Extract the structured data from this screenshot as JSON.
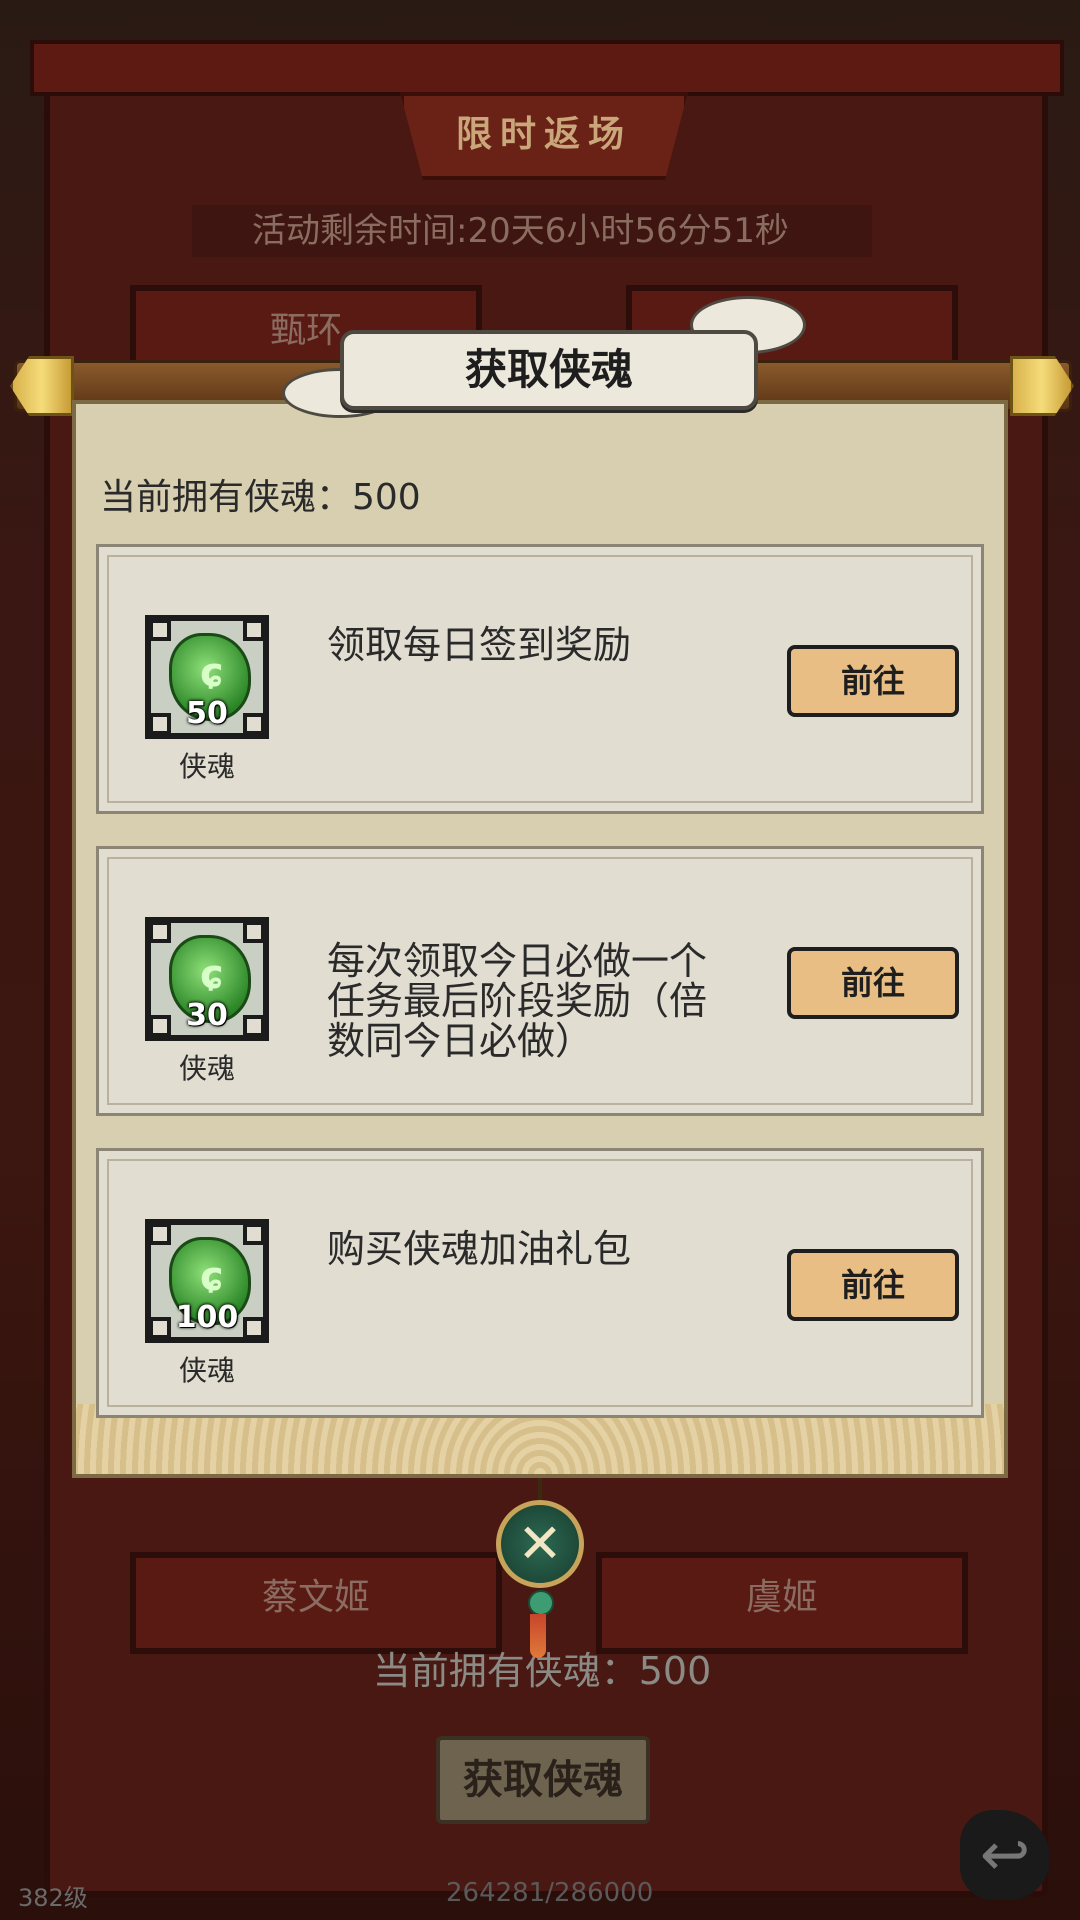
{
  "background": {
    "banner_title": "限时返场",
    "timer_text": "活动剩余时间:20天6小时56分51秒",
    "characters": [
      {
        "name": "甄环"
      },
      {
        "name": "蔡文姬"
      },
      {
        "name": "虞姬"
      }
    ],
    "owned_text": "当前拥有侠魂：500",
    "get_button_label": "获取侠魂",
    "level_text": "382级",
    "progress_text": "264281/286000"
  },
  "dialog": {
    "title": "获取侠魂",
    "owned_text": "当前拥有侠魂：500",
    "tasks": [
      {
        "reward_name": "侠魂",
        "reward_qty": "50",
        "description": "领取每日签到奖励",
        "button_label": "前往"
      },
      {
        "reward_name": "侠魂",
        "reward_qty": "30",
        "description": "每次领取今日必做一个任务最后阶段奖励（倍数同今日必做）",
        "button_label": "前往"
      },
      {
        "reward_name": "侠魂",
        "reward_qty": "100",
        "description": "购买侠魂加油礼包",
        "button_label": "前往"
      }
    ]
  },
  "icons": {
    "reward_icon": "green-soul-gem-icon",
    "close_icon": "crossed-swords-close-icon",
    "back_icon": "return-arrow-icon"
  },
  "colors": {
    "panel_bg": "#d8cfb0",
    "task_bg": "#e2ddd1",
    "button_bg": "#e9be85",
    "gem_green": "#2f8a2a",
    "rod_gold": "#d9b24c"
  }
}
